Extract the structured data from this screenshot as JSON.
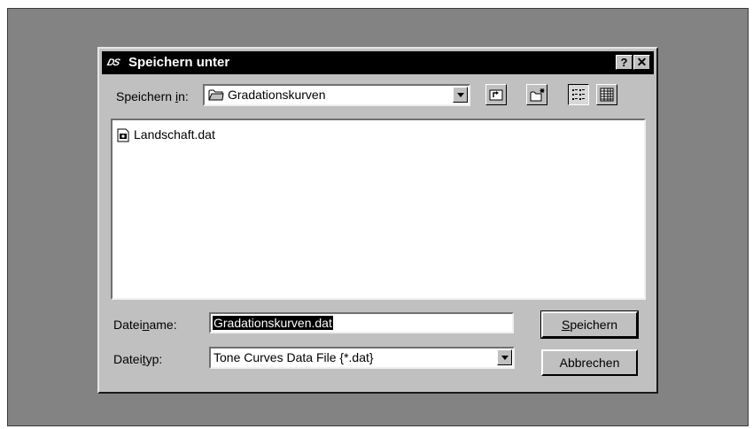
{
  "window": {
    "title": "Speichern unter",
    "app_logo": "DS",
    "help_label": "?",
    "close_label": "✕"
  },
  "save_in": {
    "label_before": "Speichern ",
    "label_accel": "i",
    "label_after": "n:",
    "value": "Gradationskurven",
    "icon": "folder-icon"
  },
  "toolbar": {
    "buttons": [
      {
        "name": "up-one-level",
        "icon": "up-folder-icon"
      },
      {
        "name": "new-folder",
        "icon": "new-folder-icon"
      },
      {
        "name": "list-view",
        "icon": "list-view-icon",
        "pressed": true
      },
      {
        "name": "details-view",
        "icon": "details-view-icon",
        "pressed": false
      }
    ]
  },
  "files": [
    {
      "name": "Landschaft.dat",
      "icon": "data-file-icon"
    }
  ],
  "filename": {
    "label_before": "Datei",
    "label_accel": "n",
    "label_after": "ame:",
    "value": "Gradationskurven.dat"
  },
  "filetype": {
    "label_before": "Datei",
    "label_accel": "t",
    "label_after": "yp:",
    "value": "Tone Curves Data File {*.dat}"
  },
  "buttons": {
    "save_accel": "S",
    "save_rest": "peichern",
    "cancel": "Abbrechen"
  }
}
